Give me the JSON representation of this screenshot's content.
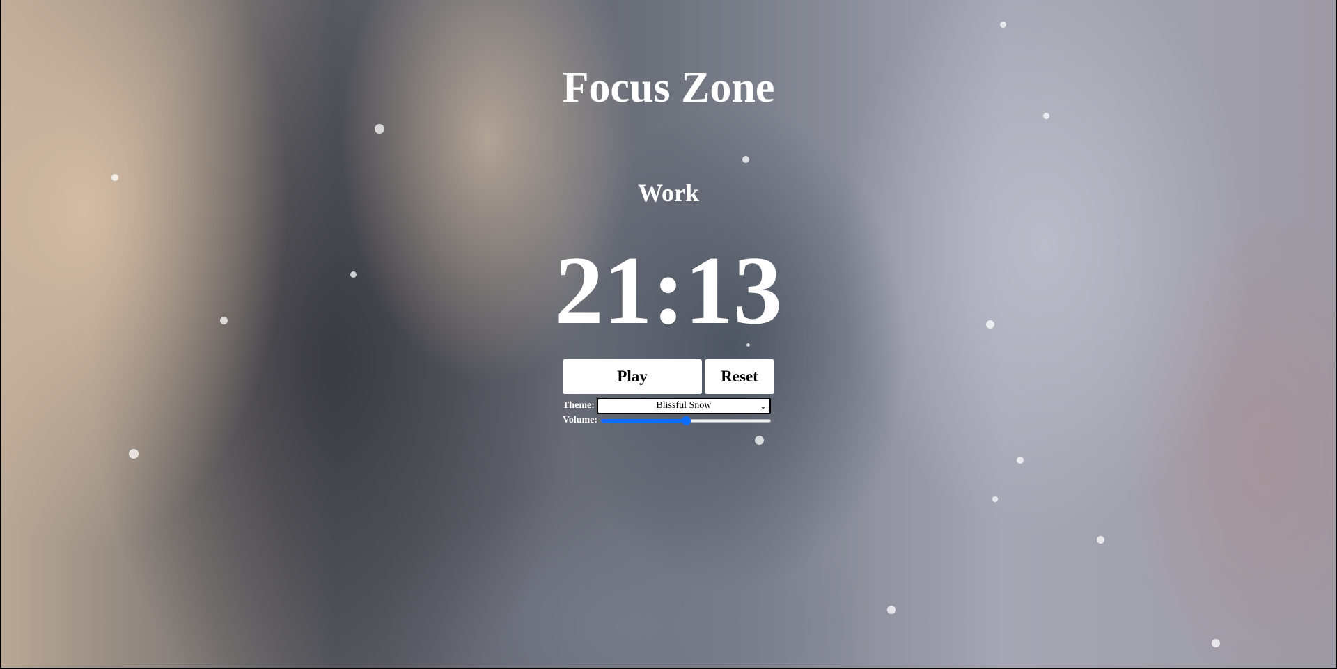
{
  "app": {
    "title": "Focus Zone"
  },
  "session": {
    "mode": "Work",
    "time_remaining": "21:13"
  },
  "controls": {
    "play_label": "Play",
    "reset_label": "Reset"
  },
  "settings": {
    "theme_label": "Theme:",
    "theme_selected": "Blissful Snow",
    "volume_label": "Volume:",
    "volume_fraction": 0.5
  },
  "colors": {
    "text": "#ffffff",
    "slider_accent": "#0d6efd",
    "button_bg": "#ffffff"
  },
  "icons": {
    "select_chevron": "chevron-down-icon"
  }
}
